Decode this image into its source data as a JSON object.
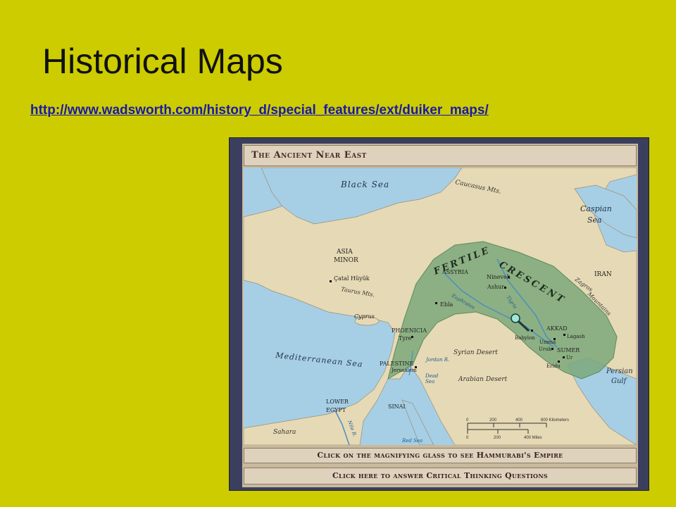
{
  "slide": {
    "title": "Historical Maps",
    "link": "http://www.wadsworth.com/history_d/special_features/ext/duiker_maps/"
  },
  "map": {
    "title": "The Ancient Near East",
    "labels": {
      "black_sea": "Black Sea",
      "caucasus": "Caucasus Mts.",
      "caspian_1": "Caspian",
      "caspian_2": "Sea",
      "asia_1": "ASIA",
      "asia_2": "MINOR",
      "catal": "Çatal Hüyük",
      "taurus": "Taurus Mts.",
      "fertile": "FERTILE",
      "crescent": "CRESCENT",
      "assyria": "ASSYRIA",
      "nineveh": "Nineveh",
      "ashur": "Ashur",
      "iran": "IRAN",
      "zagros_1": "Zagros",
      "zagros_2": "Mountains",
      "euphrates": "Euphrates",
      "tigris": "Tigris",
      "ebla": "Ebla",
      "cyprus": "Cyprus",
      "phoenicia": "PHOENICIA",
      "tyre": "Tyre",
      "akkad": "AKKAD",
      "babylon": "Babylon",
      "umma": "Umma",
      "lagash": "Lagash",
      "uruk": "Uruk",
      "sumer": "SUMER",
      "ur": "Ur",
      "eridu": "Eridu",
      "syrian_desert": "Syrian Desert",
      "mediterranean": "Mediterranean Sea",
      "palestine": "PALESTINE",
      "jordan": "Jordan R.",
      "jerusalem": "Jerusalem",
      "dead_1": "Dead",
      "dead_2": "Sea",
      "arabian_desert": "Arabian Desert",
      "persian_1": "Persian",
      "persian_2": "Gulf",
      "lower_1": "LOWER",
      "lower_2": "EGYPT",
      "sinai": "SINAI",
      "sahara": "Sahara",
      "nile": "Nile R.",
      "red_sea": "Red Sea"
    },
    "scale": {
      "km_ticks": [
        "0",
        "200",
        "400",
        "600 Kilometers"
      ],
      "mi_ticks": [
        "0",
        "200",
        "400 Miles"
      ]
    },
    "buttons": {
      "magnify": "Click on the magnifying glass to see Hammurabi's Empire",
      "questions": "Click here to answer Critical Thinking Questions"
    }
  }
}
